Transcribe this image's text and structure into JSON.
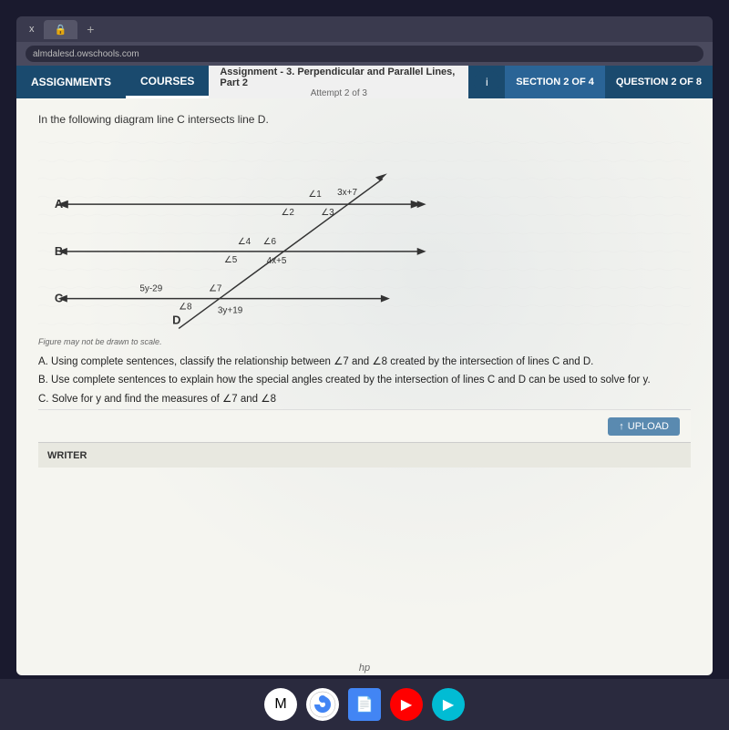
{
  "browser": {
    "tab_label": "x",
    "tab_plus": "+",
    "address": "almdalesd.owschools.com"
  },
  "header": {
    "assignments_label": "ASSIGNMENTS",
    "courses_label": "COURSES",
    "assignment_title": "Assignment - 3. Perpendicular and Parallel Lines, Part 2",
    "attempt_label": "Attempt 2 of 3",
    "section_label": "SECTION 2 OF 4",
    "question_label": "QUESTION 2 OF 8"
  },
  "problem": {
    "intro": "In the following diagram line C intersects line D.",
    "figure_note": "Figure may not be drawn to scale.",
    "question_a": "A. Using complete sentences, classify the relationship between ∠7 and ∠8 created by the intersection of lines C and D.",
    "question_b": "B. Use complete sentences to explain how the special angles created by the intersection of lines C and D can be used to solve for y.",
    "question_c": "C. Solve for y and find the measures of ∠7 and ∠8",
    "upload_label": "UPLOAD",
    "writer_label": "WRITER"
  },
  "taskbar": {
    "icons": [
      "gmail",
      "chrome",
      "docs",
      "youtube",
      "play"
    ]
  }
}
